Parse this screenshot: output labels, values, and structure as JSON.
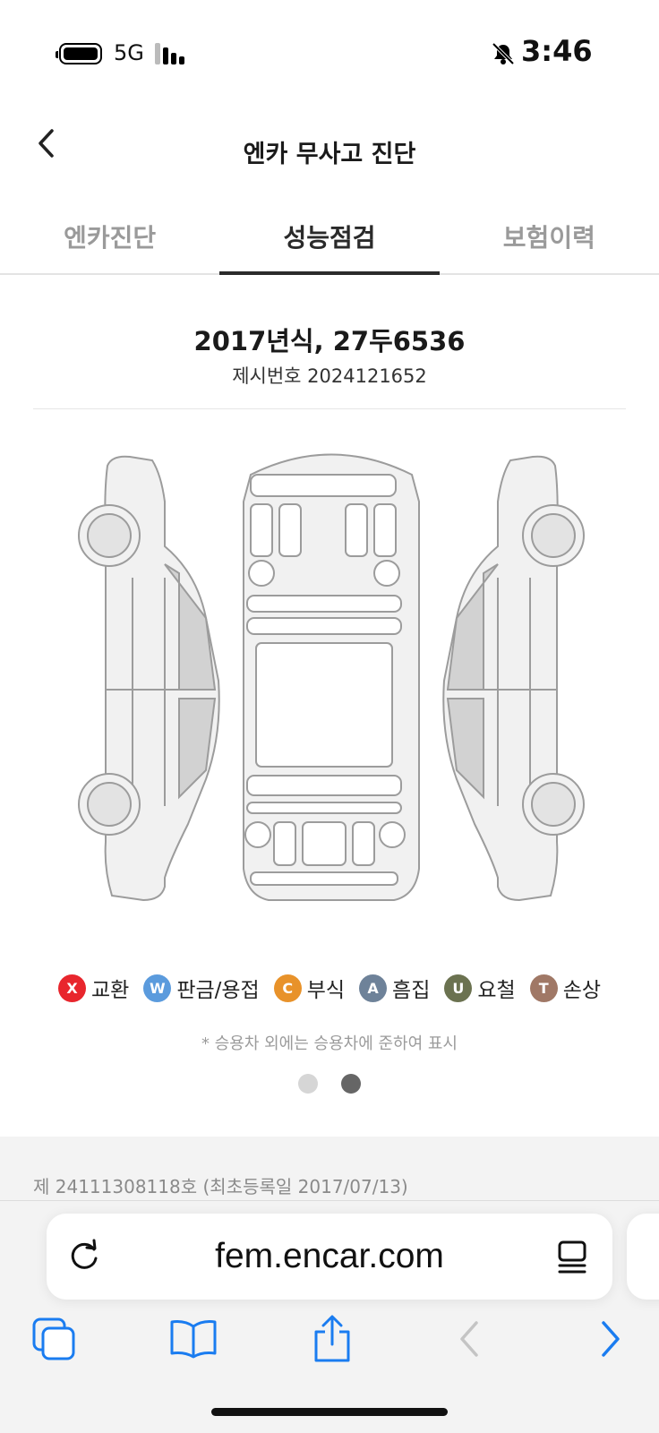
{
  "status_bar": {
    "network": "5G",
    "time": "3:46"
  },
  "header": {
    "title": "엔카 무사고 진단"
  },
  "tabs": [
    {
      "label": "엔카진단",
      "active": false
    },
    {
      "label": "성능점검",
      "active": true
    },
    {
      "label": "보험이력",
      "active": false
    }
  ],
  "vehicle": {
    "title": "2017년식, 27두6536",
    "subtitle": "제시번호 2024121652"
  },
  "legend": [
    {
      "letter": "X",
      "label": "교환",
      "color": "#e8262d"
    },
    {
      "letter": "W",
      "label": "판금/용접",
      "color": "#5b9bdd"
    },
    {
      "letter": "C",
      "label": "부식",
      "color": "#e8922a"
    },
    {
      "letter": "A",
      "label": "흠집",
      "color": "#6e8299"
    },
    {
      "letter": "U",
      "label": "요철",
      "color": "#6b7250"
    },
    {
      "letter": "T",
      "label": "손상",
      "color": "#a07866"
    }
  ],
  "note": "* 승용차 외에는 승용차에 준하여 표시",
  "pager": {
    "total": 2,
    "active_index": 1
  },
  "registration": "제 24111308118호 (최초등록일 2017/07/13)",
  "browser": {
    "url": "fem.encar.com"
  },
  "colors": {
    "accent_blue": "#1a7cf0",
    "tab_active": "#2b2b2b"
  }
}
